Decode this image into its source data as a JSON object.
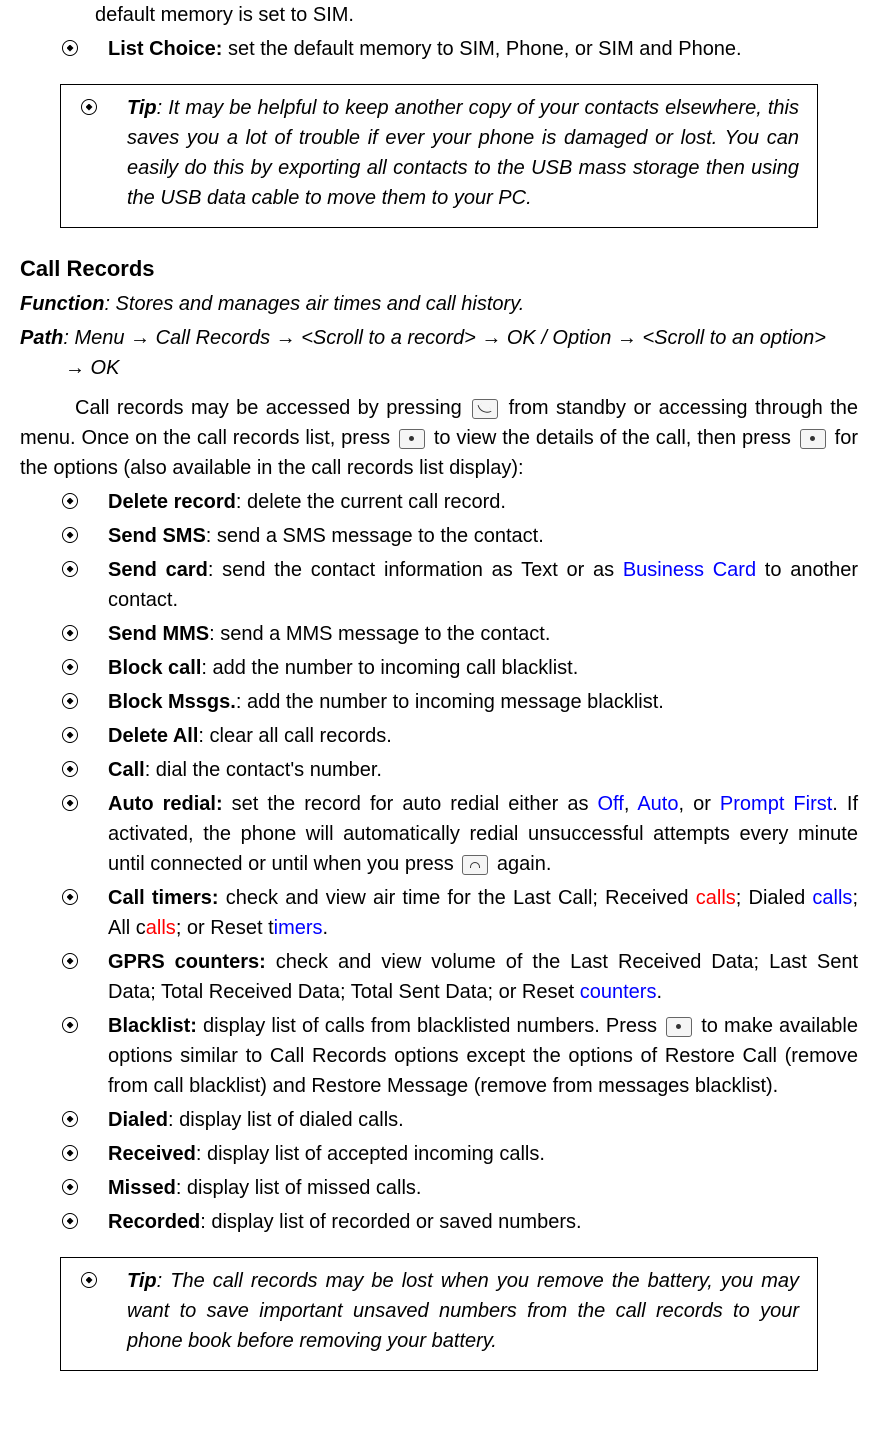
{
  "intro": "default memory is set to SIM.",
  "listChoice": {
    "label": "List Choice:",
    "text": " set the default memory to SIM, Phone, or SIM and Phone."
  },
  "tipBox1": {
    "label": "Tip",
    "text": ": It may be helpful to keep another copy of your contacts elsewhere, this saves you a lot of trouble if ever your phone is damaged or lost. You can easily do this by exporting all contacts to the USB mass storage then using the USB data cable to move them to your PC."
  },
  "sectionHeading": "Call Records",
  "functionLine": {
    "label": "Function",
    "text": ": Stores and manages air times and call history."
  },
  "pathLine": {
    "label": "Path",
    "text1": ": Menu ",
    "arrow": "→",
    "text2": " Call Records ",
    "text3": " <Scroll to a record> ",
    "text4": " OK / Option ",
    "text5": " <Scroll to an option> ",
    "text6": " OK"
  },
  "para1a": "Call records may be accessed by pressing ",
  "para1b": " from standby or accessing through the menu. Once on the call records list, press ",
  "para1c": " to view the details of the call, then press ",
  "para1d": " for the options (also available in the call records list display):",
  "items": {
    "deleteRecord": {
      "label": "Delete record",
      "text": ": delete the current call record."
    },
    "sendSms": {
      "label": "Send SMS",
      "text": ": send a SMS message to the contact."
    },
    "sendCard": {
      "label": "Send card",
      "text1": ": send the contact information as Text or as ",
      "blue": "Business Card",
      "text2": " to another contact."
    },
    "sendMms": {
      "label": "Send MMS",
      "text": ": send a MMS message to the contact."
    },
    "blockCall": {
      "label": "Block call",
      "text": ": add the number to incoming call blacklist."
    },
    "blockMsgs": {
      "label": "Block Mssgs.",
      "text": ": add the number to incoming message blacklist."
    },
    "deleteAll": {
      "label": "Delete All",
      "text": ": clear all call records."
    },
    "call": {
      "label": "Call",
      "text": ": dial the contact's number."
    },
    "autoRedial": {
      "label": "Auto redial:",
      "text1": " set the record for auto redial either as ",
      "blue1": "Off",
      "sep1": ", ",
      "blue2": "Auto",
      "sep2": ", or ",
      "blue3": "Prompt First",
      "text2": ". If activated, the phone will automatically redial unsuccessful attempts every minute until connected or until when you press ",
      "text3": " again."
    },
    "callTimers": {
      "label": "Call timers:",
      "text1": " check and view air time for the Last Call; Received ",
      "red1": "calls",
      "text2": "; Dialed ",
      "blue1": "calls",
      "text3": "; All c",
      "red2": "alls",
      "text4": "; or Reset t",
      "blue2": "imers",
      "text5": "."
    },
    "gprs": {
      "label": "GPRS counters:",
      "text1": " check and view volume of the Last Received Data; Last Sent Data; Total Received Data; Total Sent Data; or Reset ",
      "blue": "counters",
      "text2": "."
    },
    "blacklist": {
      "label": "Blacklist:",
      "text1": " display list of calls from blacklisted numbers. Press ",
      "text2": " to make available options similar to Call Records options except the options of Restore Call (remove from call blacklist) and Restore Message (remove from messages blacklist)."
    },
    "dialed": {
      "label": "Dialed",
      "text": ": display list of dialed calls."
    },
    "received": {
      "label": "Received",
      "text": ": display list of accepted incoming calls."
    },
    "missed": {
      "label": "Missed",
      "text": ": display list of missed calls."
    },
    "recorded": {
      "label": "Recorded",
      "text": ": display list of recorded or saved numbers."
    }
  },
  "tipBox2": {
    "label": "Tip",
    "text": ": The call records may be lost when you remove the battery, you may want to save important unsaved numbers from the call records to your phone book before removing your battery."
  }
}
